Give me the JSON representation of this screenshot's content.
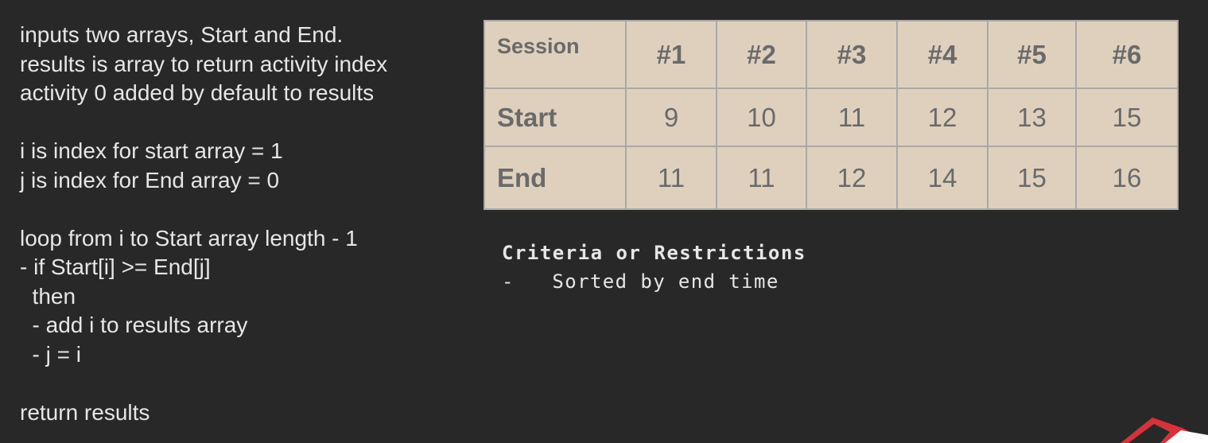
{
  "pseudocode": {
    "lines": [
      "inputs two arrays, Start and End.",
      "results is array to return activity index",
      "activity 0 added by default to results",
      "",
      "i is index for start array = 1",
      "j is index for End array = 0",
      "",
      "loop from i to Start array length - 1",
      "- if Start[i] >= End[j]",
      "  then",
      "  - add i to results array",
      "  - j = i",
      "",
      "return results"
    ]
  },
  "table": {
    "corner_label": "Session",
    "columns": [
      "#1",
      "#2",
      "#3",
      "#4",
      "#5",
      "#6"
    ],
    "rows": [
      {
        "label": "Start",
        "values": [
          "9",
          "10",
          "11",
          "12",
          "13",
          "15"
        ]
      },
      {
        "label": "End",
        "values": [
          "11",
          "11",
          "12",
          "14",
          "15",
          "16"
        ]
      }
    ]
  },
  "criteria": {
    "heading": "Criteria or Restrictions",
    "items": [
      "-   Sorted by end time"
    ]
  },
  "colors": {
    "background": "#282828",
    "text": "#e6e6e6",
    "table_fill": "#dfd0bd",
    "table_text": "#6a6a6a",
    "table_border": "#a9a9a9",
    "logo_red": "#d6323c"
  }
}
